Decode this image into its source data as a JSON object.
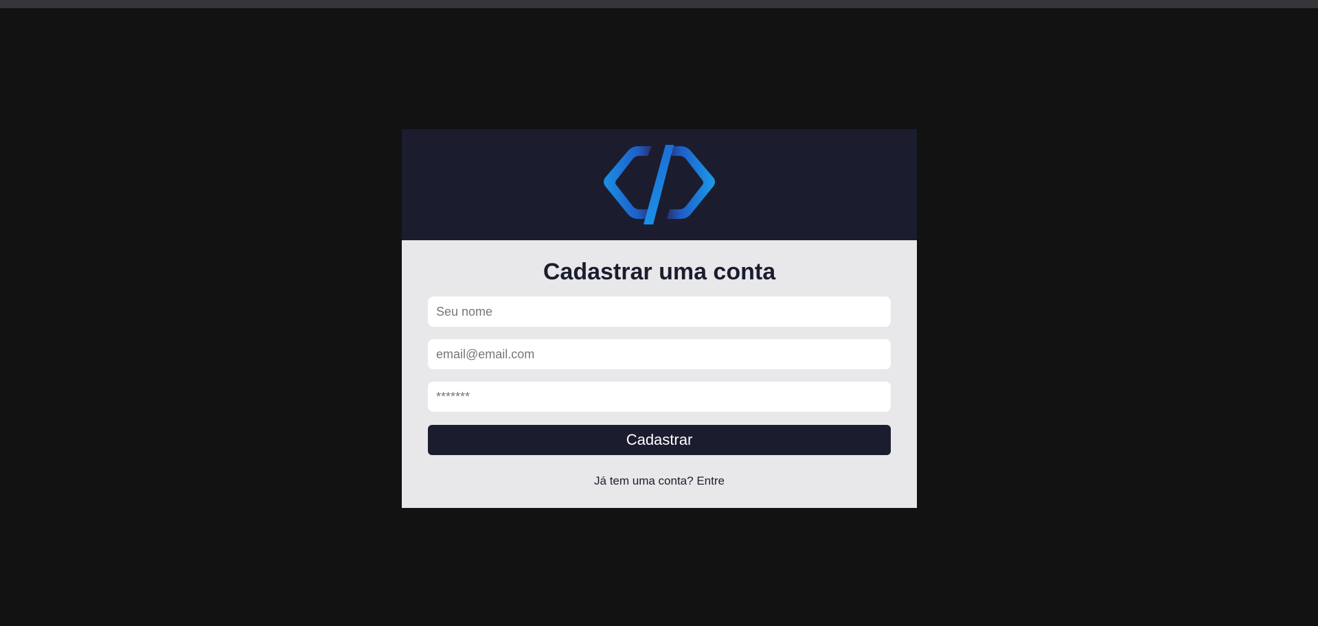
{
  "form": {
    "title": "Cadastrar uma conta",
    "name_placeholder": "Seu nome",
    "email_placeholder": "email@email.com",
    "password_placeholder": "*******",
    "submit_label": "Cadastrar",
    "login_prompt": "Já tem uma conta?",
    "login_link": "Entre"
  },
  "theme": {
    "page_background": "#121212",
    "header_background": "#1b1d2f",
    "card_background": "#e8e8ea",
    "logo_accent": "#1b8fe6"
  },
  "icons": {
    "logo": "code-brackets-logo-icon"
  }
}
